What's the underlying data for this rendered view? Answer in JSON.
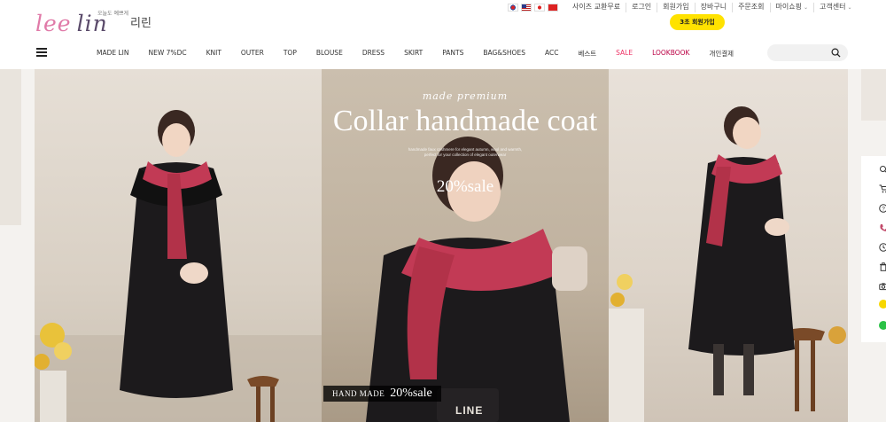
{
  "brand": {
    "logo_script_lee": "lee",
    "logo_script_lin": "lin",
    "logo_tagline": "오늘도 예쁘게",
    "logo_korean": "리린"
  },
  "language_flags": [
    "korean-flag",
    "us-flag",
    "japan-flag",
    "china-flag"
  ],
  "top_links": [
    {
      "label": "사이즈 교환무료"
    },
    {
      "label": "로그인"
    },
    {
      "label": "회원가입"
    },
    {
      "label": "장바구니"
    },
    {
      "label": "주문조회"
    },
    {
      "label": "마이쇼핑",
      "dropdown": true
    },
    {
      "label": "고객센터",
      "dropdown": true
    }
  ],
  "promo_button": "3초 회원가입",
  "nav": {
    "items": [
      "MADE LIN",
      "NEW 7%DC",
      "KNIT",
      "OUTER",
      "TOP",
      "BLOUSE",
      "DRESS",
      "SKIRT",
      "PANTS",
      "BAG&SHOES",
      "ACC",
      "베스트",
      "SALE",
      "LOOKBOOK",
      "개인결제"
    ]
  },
  "search": {
    "placeholder": "",
    "value": ""
  },
  "hero": {
    "subtitle": "made premium",
    "title": "Collar handmade coat",
    "description": "handmade faux cashmere for elegant autumn, wool and warmth, perfect for your collection of elegant outerwear",
    "sale": "20%sale",
    "badge_prefix": "HAND MADE",
    "badge_sale": "20%sale",
    "bag_label": "LINE"
  },
  "colors": {
    "accent_yellow": "#ffe200",
    "sale_pink": "#e33366",
    "lookbook": "#bb0044",
    "scarf": "#c23a55",
    "coat": "#1c1a1c"
  },
  "quick_menu_icons": [
    "search-icon",
    "cart-icon",
    "question-icon",
    "phone-icon",
    "clock-icon",
    "trash-icon",
    "camera-icon",
    "kakao-icon",
    "talk-icon"
  ]
}
